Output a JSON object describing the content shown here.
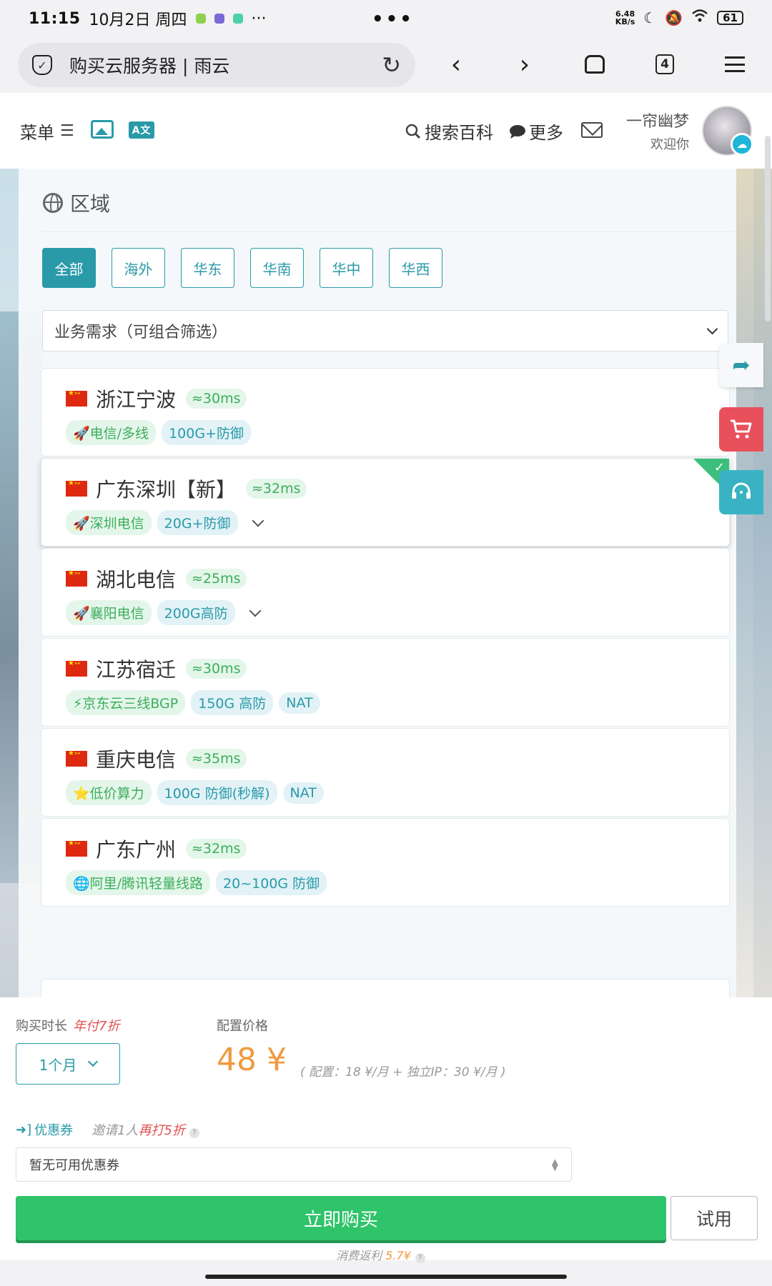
{
  "status_bar": {
    "time": "11:15",
    "date": "10月2日 周四",
    "more_dots": "···",
    "center_dots": "•••",
    "net_speed_value": "6.48",
    "net_speed_unit": "KB/s",
    "battery": "61"
  },
  "browser": {
    "url_title": "购买云服务器 | 雨云",
    "tab_count": "4"
  },
  "header": {
    "menu_label": "菜单",
    "translate_label": "A文",
    "search_label": "搜索百科",
    "more_label": "更多",
    "user_name": "一帘幽梦",
    "user_welcome": "欢迎你"
  },
  "region": {
    "title": "区域",
    "tabs": [
      {
        "label": "全部",
        "active": true
      },
      {
        "label": "海外"
      },
      {
        "label": "华东"
      },
      {
        "label": "华南"
      },
      {
        "label": "华中"
      },
      {
        "label": "华西"
      }
    ],
    "filter_placeholder": "业务需求（可组合筛选）",
    "cards": [
      {
        "name": "浙江宁波",
        "ping": "≈30ms",
        "tags": [
          "🚀电信/多线",
          "100G+防御"
        ]
      },
      {
        "name": "广东深圳【新】",
        "ping": "≈32ms",
        "tags": [
          "🚀深圳电信",
          "20G+防御"
        ]
      },
      {
        "name": "湖北电信",
        "ping": "≈25ms",
        "tags": [
          "🚀襄阳电信",
          "200G高防"
        ]
      },
      {
        "name": "江苏宿迁",
        "ping": "≈30ms",
        "tags": [
          "⚡京东云三线BGP",
          "150G 高防",
          "NAT"
        ]
      },
      {
        "name": "重庆电信",
        "ping": "≈35ms",
        "tags": [
          "⭐低价算力",
          "100G 防御(秒解)",
          "NAT"
        ]
      },
      {
        "name": "广东广州",
        "ping": "≈32ms",
        "tags": [
          "🌐阿里/腾讯轻量线路",
          "20~100G 防御"
        ]
      }
    ]
  },
  "purchase": {
    "duration_label": "购买时长",
    "duration_promo": "年付7折",
    "duration_value": "1个月",
    "price_label": "配置价格",
    "price_value": "48 ¥",
    "price_detail": "( 配置：18 ¥/月 + 独立IP：30 ¥/月 )",
    "coupon_label": "优惠券",
    "coupon_hint_prefix": "邀请1人",
    "coupon_hint_highlight": "再打5折",
    "coupon_placeholder": "暂无可用优惠券",
    "buy_label": "立即购买",
    "trial_label": "试用",
    "rebate_prefix": "消费返利",
    "rebate_value": "5.7¥"
  },
  "colors": {
    "accent": "#2a9aa8",
    "buy_green": "#2fc36a",
    "price_orange": "#f09a3e",
    "promo_red": "#e05252",
    "cart_red": "#e8505b"
  }
}
